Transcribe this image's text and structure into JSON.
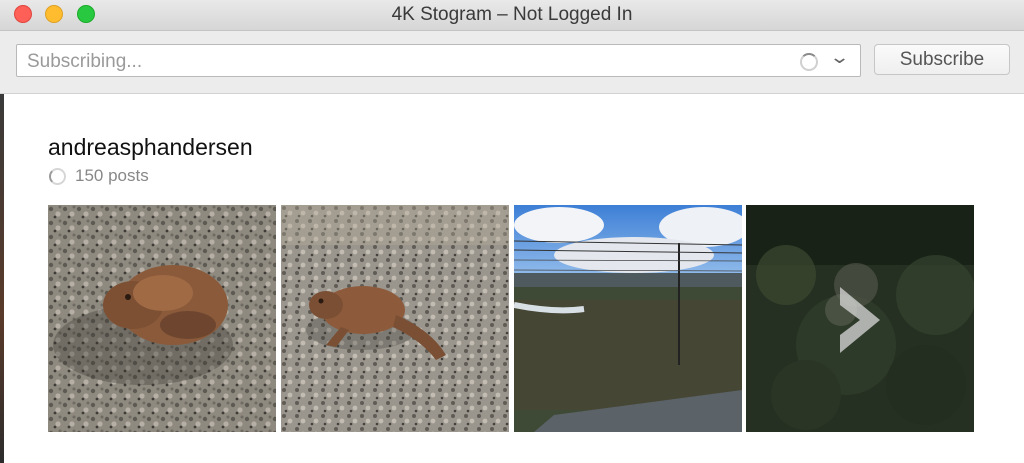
{
  "window": {
    "title": "4K Stogram – Not Logged In"
  },
  "toolbar": {
    "search_placeholder": "Subscribing...",
    "subscribe_label": "Subscribe"
  },
  "account": {
    "name": "andreasphandersen",
    "posts": "150 posts"
  },
  "icons": {
    "close": "close-window-icon",
    "minimize": "minimize-window-icon",
    "maximize": "maximize-window-icon",
    "loading": "spinner-icon",
    "dropdown": "chevron-down-icon",
    "next": "chevron-right-icon"
  },
  "colors": {
    "close": "#fe5f57",
    "minimize": "#febc2e",
    "maximize": "#28c840"
  }
}
